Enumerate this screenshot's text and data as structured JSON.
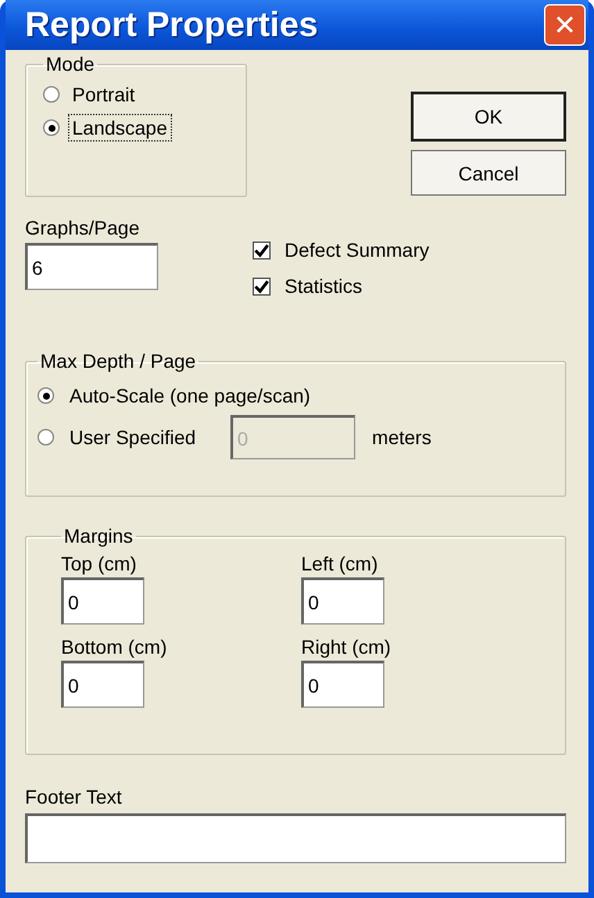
{
  "window": {
    "title": "Report Properties",
    "close": "✕"
  },
  "mode": {
    "label": "Mode",
    "options": [
      {
        "label": "Portrait",
        "selected": false
      },
      {
        "label": "Landscape",
        "selected": true
      }
    ]
  },
  "buttons": [
    {
      "label": "OK",
      "default": true
    },
    {
      "label": "Cancel",
      "default": false
    }
  ],
  "graphs_per_page": {
    "label": "Graphs/Page",
    "value": "6"
  },
  "checkboxes": [
    {
      "label": "Defect Summary",
      "checked": true
    },
    {
      "label": "Statistics",
      "checked": true
    }
  ],
  "max_depth": {
    "label": "Max Depth / Page",
    "options": [
      {
        "label": "Auto-Scale (one page/scan)",
        "selected": true
      },
      {
        "label": "User Specified",
        "selected": false
      }
    ],
    "field": {
      "value": "0",
      "disabled": true
    },
    "unit": "meters"
  },
  "margins": {
    "label": "Margins",
    "fields": [
      {
        "label": "Top (cm)",
        "value": "0"
      },
      {
        "label": "Left (cm)",
        "value": "0"
      },
      {
        "label": "Bottom (cm)",
        "value": "0"
      },
      {
        "label": "Right (cm)",
        "value": "0"
      }
    ]
  },
  "footer": {
    "label": "Footer Text"
  }
}
